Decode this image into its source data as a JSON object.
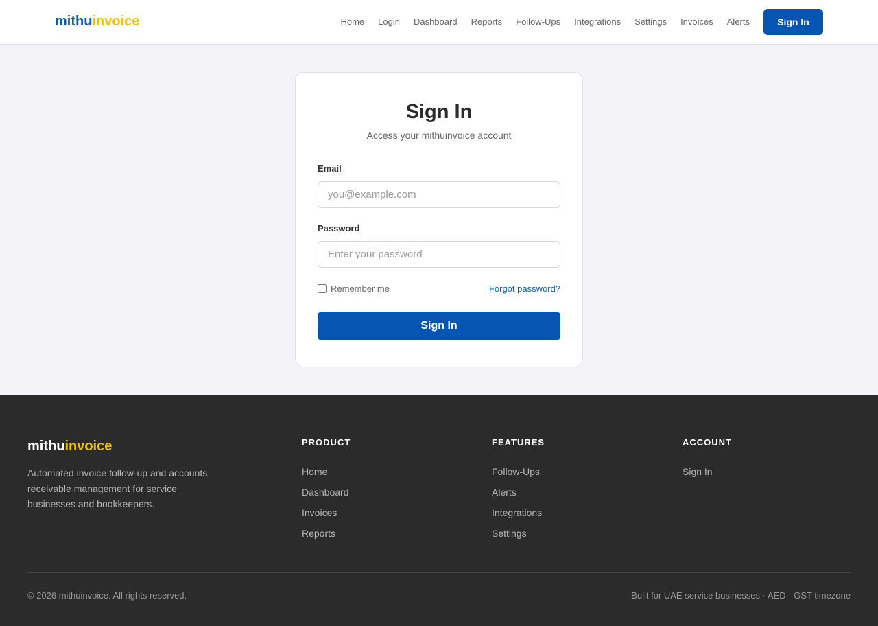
{
  "brand": {
    "part1": "mithu",
    "part2": "invoice"
  },
  "nav": {
    "items": [
      "Home",
      "Login",
      "Dashboard",
      "Reports",
      "Follow-Ups",
      "Integrations",
      "Settings",
      "Invoices",
      "Alerts"
    ],
    "signin_label": "Sign In"
  },
  "signin": {
    "title": "Sign In",
    "subtitle": "Access your mithuinvoice account",
    "email_label": "Email",
    "email_placeholder": "you@example.com",
    "password_label": "Password",
    "password_placeholder": "Enter your password",
    "remember_label": "Remember me",
    "remember_checked": false,
    "forgot_label": "Forgot password?",
    "submit_label": "Sign In"
  },
  "footer": {
    "description": "Automated invoice follow-up and accounts receivable management for service businesses and bookkeepers.",
    "columns": [
      {
        "heading": "PRODUCT",
        "links": [
          "Home",
          "Dashboard",
          "Invoices",
          "Reports"
        ]
      },
      {
        "heading": "FEATURES",
        "links": [
          "Follow-Ups",
          "Alerts",
          "Integrations",
          "Settings"
        ]
      },
      {
        "heading": "ACCOUNT",
        "links": [
          "Sign In"
        ]
      }
    ],
    "copyright": "© 2026 mithuinvoice. All rights reserved.",
    "note": "Built for UAE service businesses · AED · GST timezone"
  },
  "colors": {
    "brand_blue": "#0b5cb0",
    "brand_yellow": "#f2c300",
    "primary_button": "#0755b2",
    "footer_bg": "#2b2b2b",
    "page_bg": "#f3f3f8"
  }
}
